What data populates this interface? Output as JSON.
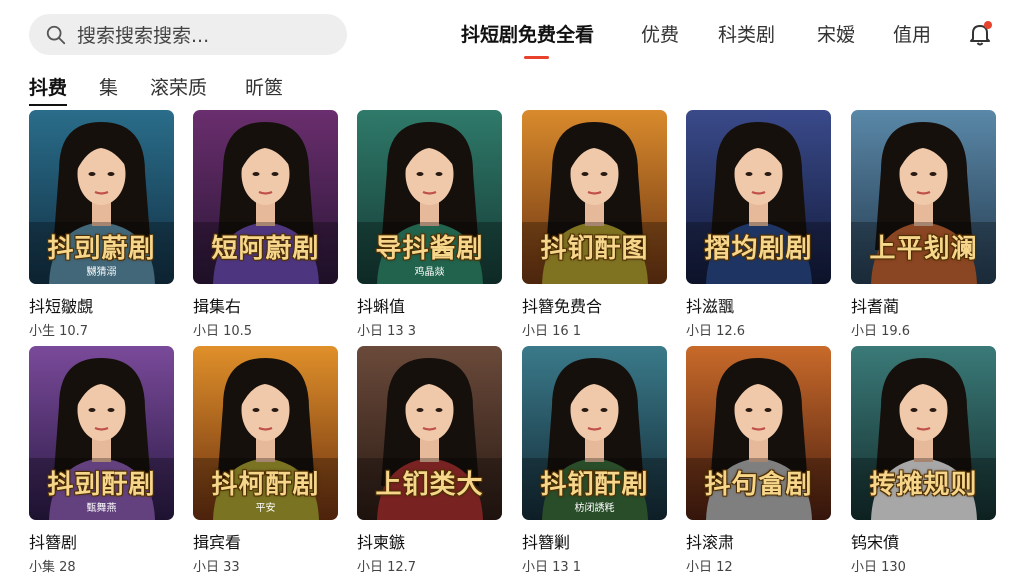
{
  "search": {
    "placeholder": "搜索搜索搜索..."
  },
  "nav": {
    "items": [
      "抖短剧免费全看",
      "优费",
      "科类剧",
      "宋嫒",
      "值用"
    ],
    "active_index": 0
  },
  "subtabs": {
    "items": [
      "抖费",
      "集",
      "滚荣质",
      "昕篋"
    ],
    "active_index": 0
  },
  "colors": {
    "accent": "#e8412c",
    "text": "#222222",
    "search_bg": "#eeeeee"
  },
  "icons": {
    "search": "search-icon",
    "bell": "bell-icon"
  },
  "cards": [
    {
      "title": "抖剅蔚剧",
      "subtitle": "嬲猜溺",
      "name": "抖短皺覷",
      "meta": "小生 10.7",
      "theme": [
        "#2a6d8a",
        "#123044"
      ],
      "shirt": "#5b8fa8"
    },
    {
      "title": "短阿蔚剧",
      "subtitle": "",
      "name": "揖集右",
      "meta": "小日 10.5",
      "theme": [
        "#6a2e6e",
        "#2a1636"
      ],
      "shirt": "#6b4bb0"
    },
    {
      "title": "导抖酱剧",
      "subtitle": "鸡晶燚",
      "name": "抖蝌值",
      "meta": "小日 13 3",
      "theme": [
        "#2f7a6a",
        "#153a34"
      ],
      "shirt": "#2f8a6a"
    },
    {
      "title": "抖钔酑图",
      "subtitle": "",
      "name": "抖簪免费合",
      "meta": "小日 16 1",
      "theme": [
        "#d98a2c",
        "#6a3412"
      ],
      "shirt": "#b0a030"
    },
    {
      "title": "摺均剧剧",
      "subtitle": "",
      "name": "抖滋飁",
      "meta": "小日 12.6",
      "theme": [
        "#3a4a8a",
        "#121a3a"
      ],
      "shirt": "#2a4a8a"
    },
    {
      "title": "上平刬澜",
      "subtitle": "",
      "name": "抖耆蔺",
      "meta": "小日 19.6",
      "theme": [
        "#5a88a8",
        "#243a4e"
      ],
      "shirt": "#c06030"
    },
    {
      "title": "抖剅酑剧",
      "subtitle": "甄舞燕",
      "name": "抖簪剧",
      "meta": "小集 28",
      "theme": [
        "#7a4a9a",
        "#2a1a44"
      ],
      "shirt": "#8a5ab0"
    },
    {
      "title": "抖柯酑剧",
      "subtitle": "平安",
      "name": "揖宾看",
      "meta": "小日 33",
      "theme": [
        "#e0902a",
        "#6a3010"
      ],
      "shirt": "#a8a030"
    },
    {
      "title": "上钔类大",
      "subtitle": "",
      "name": "抖柬鏃",
      "meta": "小日 12.7",
      "theme": [
        "#6a4a3a",
        "#2a1a14"
      ],
      "shirt": "#a83030"
    },
    {
      "title": "抖钔酑剧",
      "subtitle": "枋闭誘粍",
      "name": "抖簪剿",
      "meta": "小日 13 1",
      "theme": [
        "#3a7a8a",
        "#142a36"
      ],
      "shirt": "#3a6a3a"
    },
    {
      "title": "抖句畣剧",
      "subtitle": "",
      "name": "抖滚肃",
      "meta": "小日 12",
      "theme": [
        "#c86a2a",
        "#4a1e10"
      ],
      "shirt": "#b0b0b0"
    },
    {
      "title": "抟摊规则",
      "subtitle": "",
      "name": "钨宋僨",
      "meta": "小日 130",
      "theme": [
        "#3a7a78",
        "#142e2e"
      ],
      "shirt": "#e8e8e8"
    }
  ]
}
